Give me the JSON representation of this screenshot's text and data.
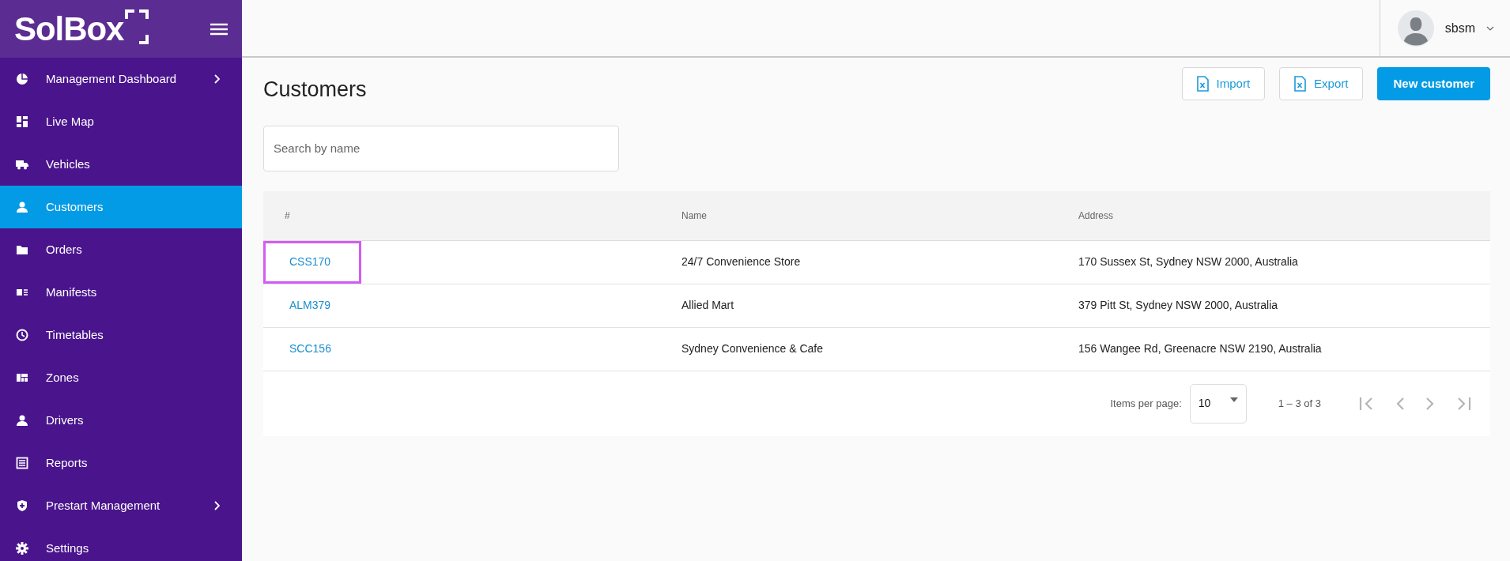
{
  "sidebar": {
    "logo": "SolBox",
    "items": [
      {
        "label": "Management Dashboard",
        "has_submenu": true,
        "selected": false
      },
      {
        "label": "Live Map",
        "has_submenu": false,
        "selected": false
      },
      {
        "label": "Vehicles",
        "has_submenu": false,
        "selected": false
      },
      {
        "label": "Customers",
        "has_submenu": false,
        "selected": true
      },
      {
        "label": "Orders",
        "has_submenu": false,
        "selected": false
      },
      {
        "label": "Manifests",
        "has_submenu": false,
        "selected": false
      },
      {
        "label": "Timetables",
        "has_submenu": false,
        "selected": false
      },
      {
        "label": "Zones",
        "has_submenu": false,
        "selected": false
      },
      {
        "label": "Drivers",
        "has_submenu": false,
        "selected": false
      },
      {
        "label": "Reports",
        "has_submenu": false,
        "selected": false
      },
      {
        "label": "Prestart Management",
        "has_submenu": true,
        "selected": false
      },
      {
        "label": "Settings",
        "has_submenu": false,
        "selected": false
      }
    ]
  },
  "header": {
    "user": "sbsm"
  },
  "page": {
    "title": "Customers",
    "buttons": [
      {
        "label": "Import",
        "kind": "excel"
      },
      {
        "label": "Export",
        "kind": "excel"
      },
      {
        "label": "New customer",
        "kind": "primary"
      }
    ],
    "search": {
      "placeholder": "Search by name"
    }
  },
  "table": {
    "columns": [
      "#",
      "Name",
      "Address"
    ],
    "rows": [
      {
        "id": "CSS170",
        "name": "24/7 Convenience Store",
        "address": "170 Sussex St, Sydney NSW 2000, Australia",
        "highlighted": true
      },
      {
        "id": "ALM379",
        "name": "Allied Mart",
        "address": "379 Pitt St, Sydney NSW 2000, Australia",
        "highlighted": false
      },
      {
        "id": "SCC156",
        "name": "Sydney Convenience & Cafe",
        "address": "156 Wangee Rd, Greenacre NSW 2190, Australia",
        "highlighted": false
      }
    ]
  },
  "paginator": {
    "label": "Items per page:",
    "page_size": "10",
    "range": "1 – 3 of 3"
  }
}
